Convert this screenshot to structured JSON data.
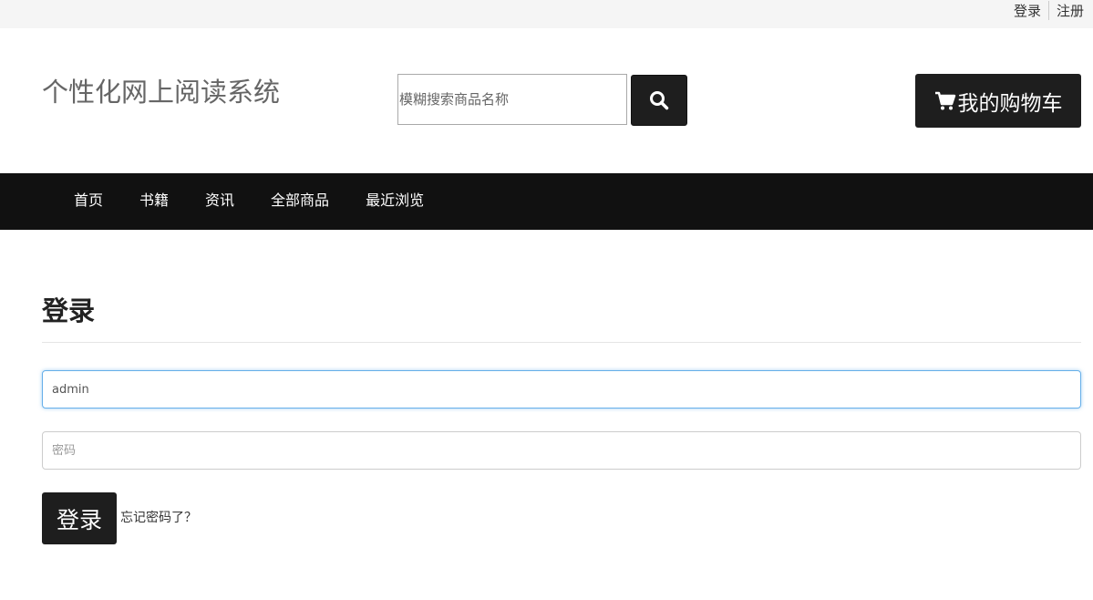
{
  "topbar": {
    "login_link": "登录",
    "register_link": "注册"
  },
  "header": {
    "brand": "个性化网上阅读系统",
    "search": {
      "placeholder": "模糊搜索商品名称",
      "value": ""
    },
    "search_icon": "search-icon",
    "cart_icon": "cart-icon",
    "cart_label": "我的购物车"
  },
  "nav": {
    "items": [
      "首页",
      "书籍",
      "资讯",
      "全部商品",
      "最近浏览"
    ]
  },
  "login_form": {
    "title": "登录",
    "username": {
      "value": "admin",
      "placeholder": ""
    },
    "password": {
      "value": "",
      "placeholder": "密码"
    },
    "submit_label": "登录",
    "forgot_link": "忘记密码了？"
  },
  "colors": {
    "dark": "#1e1e1e",
    "nav_bg": "#111111",
    "focus": "#66afe9"
  }
}
